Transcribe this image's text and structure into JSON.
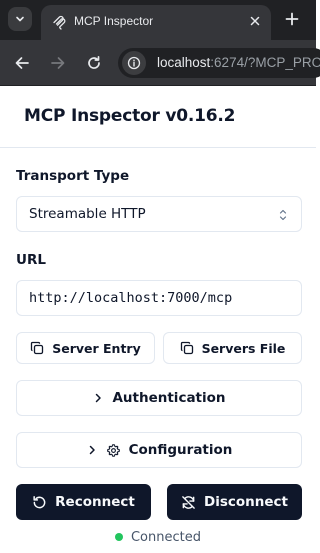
{
  "browser": {
    "tab_title": "MCP Inspector",
    "url_host": "localhost",
    "url_rest": ":6274/?MCP_PRO"
  },
  "header": {
    "title": "MCP Inspector v0.16.2"
  },
  "transport": {
    "label": "Transport Type",
    "selected": "Streamable HTTP"
  },
  "url_field": {
    "label": "URL",
    "value": "http://localhost:7000/mcp"
  },
  "buttons": {
    "server_entry": "Server Entry",
    "servers_file": "Servers File",
    "authentication": "Authentication",
    "configuration": "Configuration",
    "reconnect": "Reconnect",
    "disconnect": "Disconnect"
  },
  "status": {
    "text": "Connected",
    "color": "#22c55e"
  },
  "colors": {
    "primary": "#0f172a",
    "border": "#e2e8f0",
    "chrome_dark": "#202124",
    "chrome_tab": "#35363a"
  }
}
